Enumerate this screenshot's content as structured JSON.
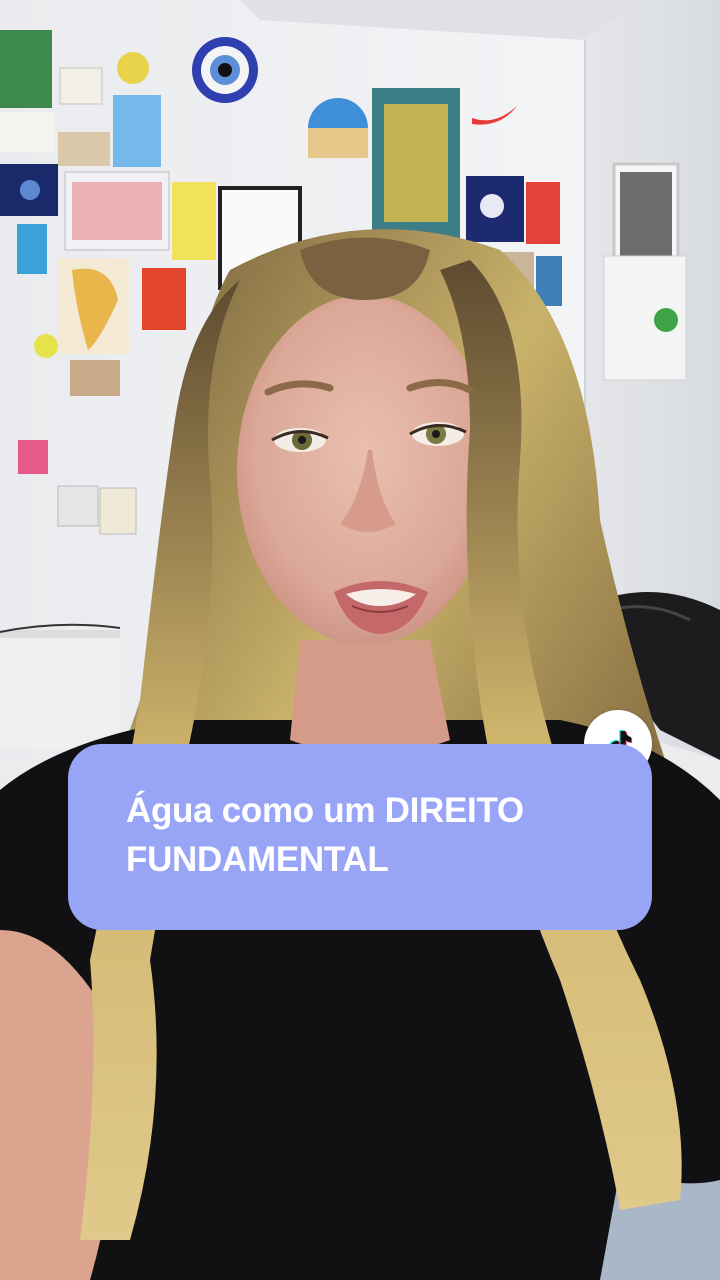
{
  "caption": {
    "line1": "Água como um DIREITO",
    "line2": "FUNDAMENTAL",
    "background": "#98a5f7",
    "text_color": "#ffffff"
  },
  "badge": {
    "icon": "tiktok-logo-icon"
  }
}
